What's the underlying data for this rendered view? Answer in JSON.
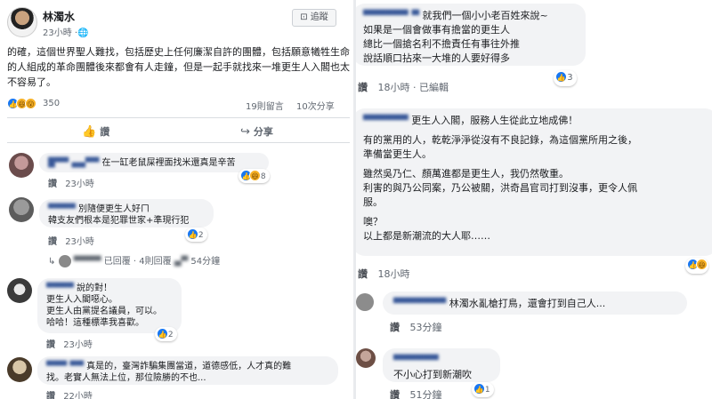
{
  "post": {
    "author": "林濁水",
    "time": "23小時",
    "follow_label": "追蹤",
    "text": "的確，這個世界聖人難找，包括歷史上任何廉潔自許的團體，包括願意犧牲生命的人組成的革命團體後來都會有人走鐘，但是一起手就找來一堆更生人入閣也太不容易了。",
    "reaction_count": "350",
    "comments_count": "19則留言",
    "shares_count": "10次分享",
    "like_action": "讚",
    "share_action": "分享"
  },
  "left_comments": [
    {
      "name": "█▀▀ ▄▄▀▀",
      "text": "在一缸老鼠屎裡面找米還真是辛苦",
      "like": "讚",
      "time": "23小時",
      "reaction": "8"
    },
    {
      "name": "▀▀▀▀",
      "text_line1": "別隨便更生人好ㄇ",
      "text_line2": "韓支友們根本是犯罪世家+準現行犯",
      "like": "讚",
      "time": "23小時",
      "reaction": "2",
      "reply_text": "已回覆",
      "reply_time": "4則回覆",
      "reply_meta": "54分鐘"
    },
    {
      "name": "▀▀▀▀",
      "lines": [
        "說的對！",
        "更生人入閣噁心。",
        "更生人由黨提名議員，可以。",
        "哈哈！這種標準我喜歡。"
      ],
      "like": "讚",
      "time": "23小時",
      "reaction": "2"
    },
    {
      "name": "▀▀▀ ▀▀",
      "text_line1": "真是的，臺灣詐騙集團當道，道德感低，人才真的難",
      "text_line2": "找。老實人無法上位，那位險勝的不也...",
      "like": "讚",
      "time": "22小時"
    }
  ],
  "right_comments": [
    {
      "name": "▀▀▀▀▀▀ ▀",
      "lines": [
        "就我們一個小小老百姓來說~",
        "如果是一個會做事有擔當的更生人",
        "總比一個搶名利不擔責任有事往外推",
        "說話順口拈來一大堆的人要好得多"
      ],
      "like": "讚",
      "time": "18小時",
      "edited": "已編輯",
      "reaction": "3"
    },
    {
      "name": "▀▀▀▀▀▀",
      "lines": [
        "更生人入閣，服務人生從此立地成佛！",
        "",
        "有的黨用的人，乾乾淨淨從沒有不良記錄，為這個黨所用之後，",
        "準備當更生人。",
        "",
        "雖然吳乃仁、顏萬進都是更生人，我仍然敬重。",
        "利害的與乃公同案，乃公被關，洪奇昌官司打到沒事，更令人佩",
        "服。",
        "",
        "噢？",
        "以上都是新潮流的大人耶……"
      ],
      "like": "讚",
      "time": "18小時"
    },
    {
      "name": "▀▀▀▀▀▀▀",
      "text": "林濁水亂槍打鳥，還會打到自己人...",
      "like": "讚",
      "time": "53分鐘"
    },
    {
      "name": "▀▀▀▀▀▀",
      "text": "不小心打到新潮吹",
      "like": "讚",
      "time": "51分鐘",
      "reaction": "1"
    }
  ],
  "colors": {
    "link": "#385898",
    "like_blue": "#1877f2",
    "bubble": "#f2f3f5",
    "meta": "#606770"
  }
}
